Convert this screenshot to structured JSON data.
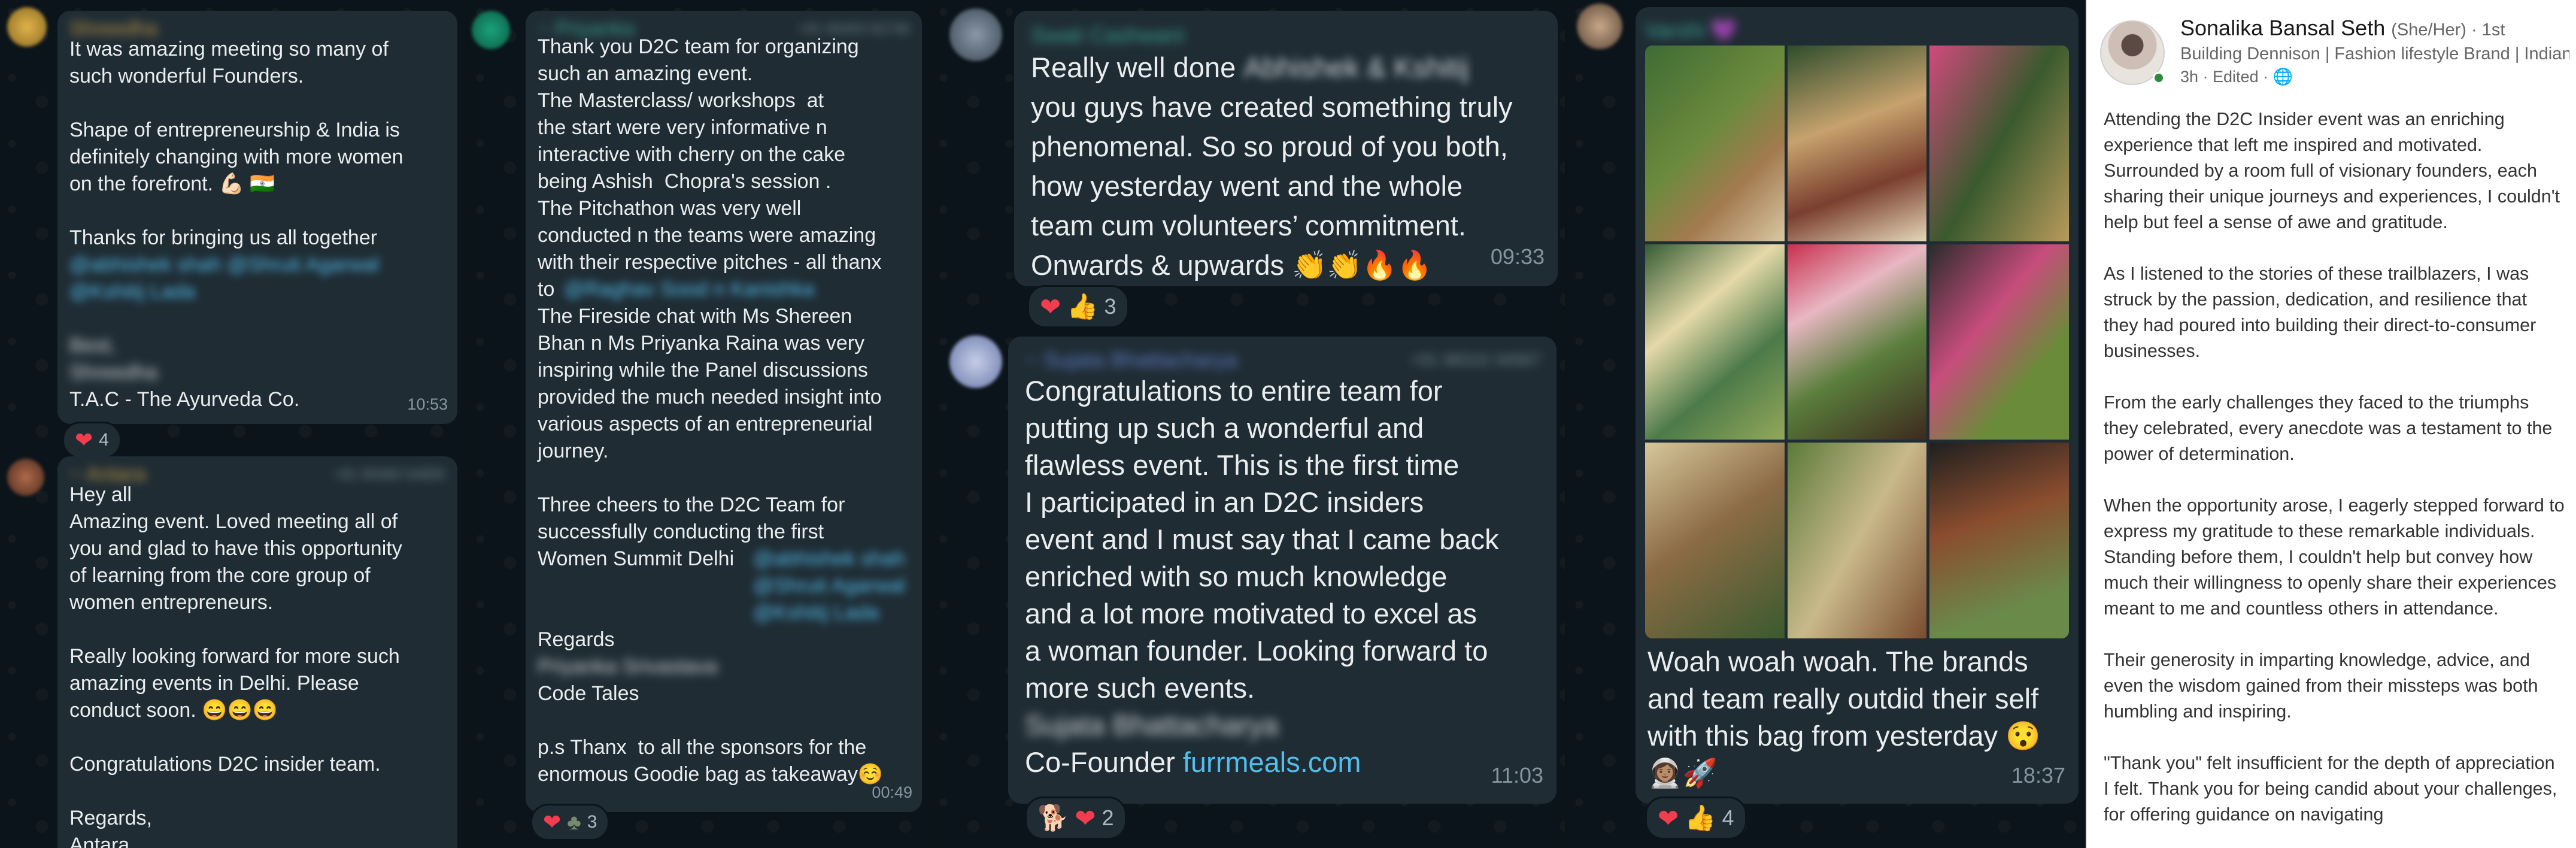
{
  "chat1": {
    "msg1": {
      "sender": "Shreedha",
      "text": "It was amazing meeting so many of\nsuch wonderful Founders.\n\nShape of entrepreneurship & India is\ndefinitely changing with more women\non the forefront. 💪🏻 🇮🇳\n\nThanks for bringing us all together",
      "mentions": "@abhishek shah @Shruti Agarwal\n@Kshitij Lada",
      "signoff": "Best,\nShreedha",
      "company": "T.A.C - The Ayurveda Co.",
      "time": "10:53",
      "reaction_count": "4"
    },
    "msg2": {
      "sender": "~ Antara",
      "phone": "+91 90360 54855",
      "text": "Hey all\nAmazing event. Loved meeting all of\nyou and glad to have this opportunity\nof learning from the core group of\nwomen entrepreneurs.\n\nReally looking forward for more such\namazing events in Delhi. Please\nconduct soon. 😄😄😄\n\nCongratulations D2C insider team.\n\nRegards,\nAntara"
    }
  },
  "chat2": {
    "msg1": {
      "sender": "~ Priyanka",
      "phone": "+91 95403 92746",
      "text_a": "Thank you D2C team for organizing\nsuch an amazing event.\nThe Masterclass/ workshops  at\nthe start were very informative n\ninteractive with cherry on the cake\nbeing Ashish  Chopra's session .\nThe Pitchathon was very well\nconducted n the teams were amazing\nwith their respective pitches - all thanx\nto",
      "mention_a": "@Raghav Sood n Kanishka",
      "text_b": "The Fireside chat with Ms Shereen\nBhan n Ms Priyanka Raina was very\ninspiring while the Panel discussions\nprovided the much needed insight into\nvarious aspects of an entrepreneurial\njourney.\n\nThree cheers to the D2C Team for\nsuccessfully conducting the first\nWomen Summit Delhi",
      "mention_b": "@abhishek shah @Shruti Agarwal @Kshitij Lada",
      "text_c": "Regards",
      "signer": "Priyanka Srivastava",
      "text_d": "Code Tales\n\np.s Thanx  to all the sponsors for the\nenormous Goodie bag as takeaway☺️",
      "time": "00:49",
      "reaction_count": "3"
    }
  },
  "chat3": {
    "msg1": {
      "sender": "Swati Cashwani",
      "line1": "Really well done",
      "mention": "Abhishek & Kshitij",
      "text": "you guys have created something truly\nphenomenal. So so proud of you both,\nhow yesterday went and the whole\nteam cum volunteers’ commitment.\nOnwards & upwards 👏👏🔥🔥",
      "time": "09:33",
      "reaction_count": "3"
    },
    "msg2": {
      "sender": "~ Sujata Bhattacharya",
      "phone": "+91 98310 34567",
      "text": "Congratulations to entire team for\nputting up such a wonderful and\nflawless event. This is the first time\nI participated in an D2C insiders\nevent and I must say that I came back\nenriched with so much knowledge\nand a lot more motivated to excel as\na woman founder. Looking forward to\nmore such events.",
      "signer": "Sujata Bhattacharya",
      "cofounder_label": "Co-Founder",
      "link": "furrmeals.com",
      "time": "11:03",
      "reaction_count": "2"
    }
  },
  "chat4": {
    "msg1": {
      "sender": "Varshi 💜",
      "text": "Woah woah woah. The brands\nand team really outdid their self\nwith this bag from yesterday 😯\n👩🏽‍🚀🚀",
      "time": "18:37",
      "reaction_count": "4"
    }
  },
  "linkedin": {
    "name": "Sonalika Bansal Seth",
    "pronouns": "(She/Her) · 1st",
    "headline": "Building Dennison | Fashion lifestyle Brand | Indian ...",
    "meta": "3h · Edited · 🌐",
    "paragraphs": [
      "Attending the D2C Insider event was an enriching experience that left me inspired and motivated. Surrounded by a room full of visionary founders, each sharing their unique journeys and experiences, I couldn't help but feel a sense of awe and gratitude.",
      "As I listened to the stories of these trailblazers, I was struck by the passion, dedication, and resilience that they had poured into building their direct-to-consumer businesses.",
      "From the early challenges they faced to the triumphs they celebrated, every anecdote was a testament to the power of determination.",
      "When the opportunity arose, I eagerly stepped forward to express my gratitude to these remarkable individuals. Standing before them, I couldn't help but convey how much their willingness to openly share their experiences meant to me and countless others in attendance.",
      "Their generosity in imparting knowledge, advice, and even the wisdom gained from their missteps was both humbling and inspiring.",
      "\"Thank you\" felt insufficient for the depth of appreciation I felt. Thank you for being candid about your challenges, for offering guidance on navigating"
    ]
  }
}
